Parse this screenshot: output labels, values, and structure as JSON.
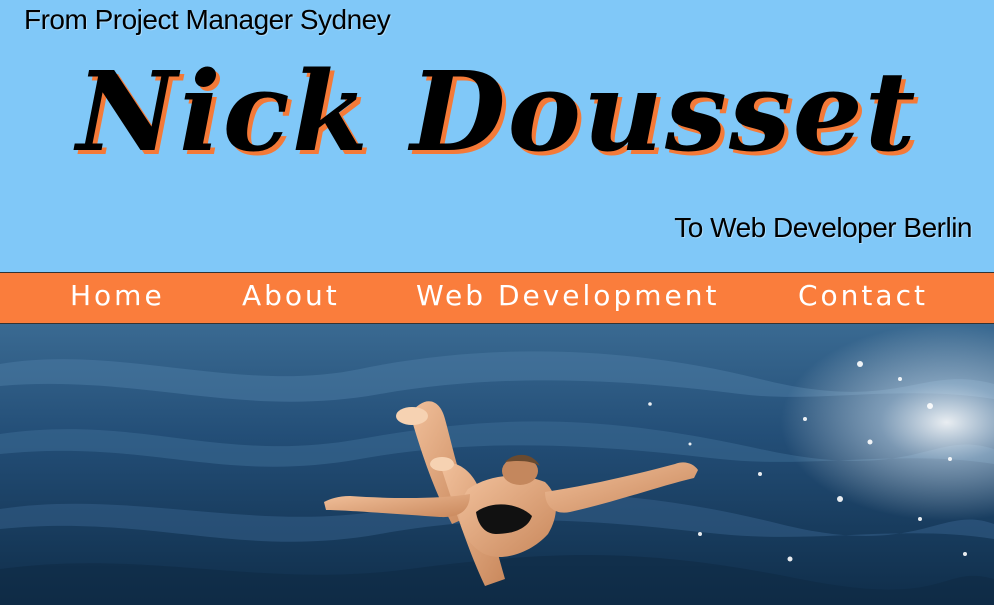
{
  "header": {
    "from_text": "From Project Manager Sydney",
    "name": "Nick Dousset",
    "to_text": "To Web Developer Berlin",
    "colors": {
      "background": "#80c8f8",
      "name_shadow": "#f47a38"
    }
  },
  "nav": {
    "background": "#fa7d3c",
    "items": [
      {
        "label": "Home"
      },
      {
        "label": "About"
      },
      {
        "label": "Web Development"
      },
      {
        "label": "Contact"
      }
    ]
  },
  "hero": {
    "image_alt": "person diving into the sea",
    "icon": "diver-photo"
  }
}
